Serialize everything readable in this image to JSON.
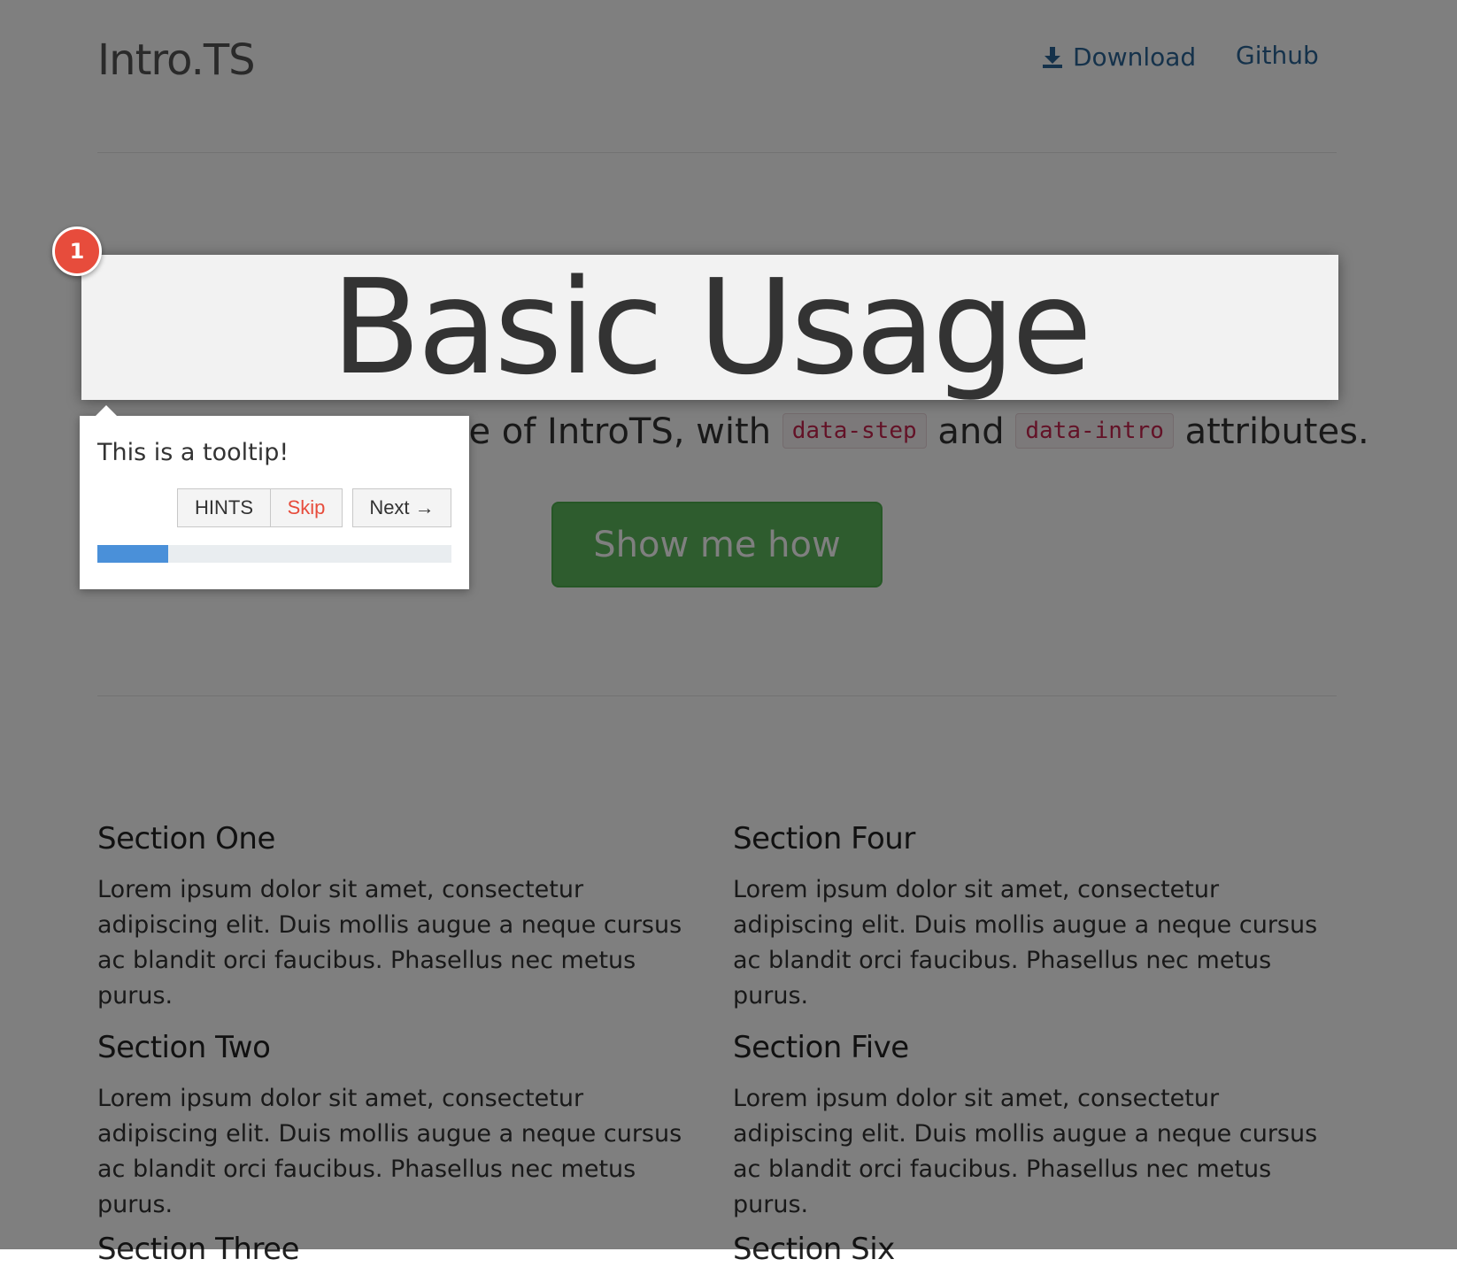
{
  "header": {
    "brand": "Intro.TS",
    "nav": {
      "download_label": "Download",
      "github_label": "Github"
    }
  },
  "hero": {
    "title": "Basic Usage",
    "lead_prefix": "This is the basic usage of IntroTS, with",
    "code_step": "data-step",
    "lead_and": "and",
    "code_intro": "data-intro",
    "lead_suffix": "attributes.",
    "button_label": "Show me how"
  },
  "sections": [
    {
      "title": "Section One",
      "body": "Lorem ipsum dolor sit amet, consectetur adipiscing elit. Duis mollis augue a neque cursus ac blandit orci faucibus. Phasellus nec metus purus."
    },
    {
      "title": "Section Two",
      "body": "Lorem ipsum dolor sit amet, consectetur adipiscing elit. Duis mollis augue a neque cursus ac blandit orci faucibus. Phasellus nec metus purus."
    },
    {
      "title": "Section Three",
      "body": ""
    },
    {
      "title": "Section Four",
      "body": "Lorem ipsum dolor sit amet, consectetur adipiscing elit. Duis mollis augue a neque cursus ac blandit orci faucibus. Phasellus nec metus purus."
    },
    {
      "title": "Section Five",
      "body": "Lorem ipsum dolor sit amet, consectetur adipiscing elit. Duis mollis augue a neque cursus ac blandit orci faucibus. Phasellus nec metus purus."
    },
    {
      "title": "Section Six",
      "body": ""
    }
  ],
  "tour": {
    "step_number": "1",
    "tooltip_text": "This is a tooltip!",
    "hints_label": "HINTS",
    "skip_label": "Skip",
    "next_label": "Next →",
    "progress_fraction": 0.2
  },
  "colors": {
    "link": "#2a6496",
    "button_success": "#5cb85c",
    "step_badge": "#e74c3c",
    "progress_fill": "#4a90d9",
    "code_text": "#c7254e"
  },
  "icons": {
    "download": "download-icon"
  }
}
